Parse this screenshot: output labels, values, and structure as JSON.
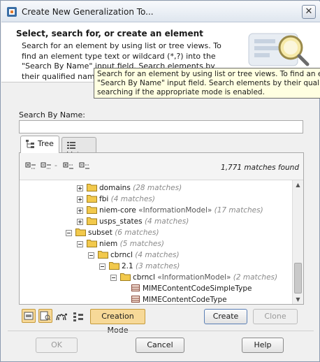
{
  "window": {
    "title": "Create New Generalization To..."
  },
  "header": {
    "title": "Select, search for, or create an element",
    "description": "Search for an element by using list or tree views. To find an element type text or wildcard (*,?) into the \"Search By Name\" input field. Search elements by their qualified names or use camel case when sear"
  },
  "tooltip": {
    "line1": "Search for an element by using list or tree views. To find an element",
    "line2": "\"Search By Name\" input field. Search elements by their qualified na",
    "line3": "searching if the appropriate mode is enabled."
  },
  "search": {
    "label": "Search By Name:",
    "value": ""
  },
  "tabs": [
    {
      "label": "Tree",
      "active": true
    },
    {
      "label": "List",
      "active": false
    }
  ],
  "tree": {
    "matches_found": "1,771 matches found",
    "rows": [
      {
        "name": "domains",
        "stereotype": "",
        "matches": "(28 matches)",
        "type": "folder",
        "expanded": false
      },
      {
        "name": "fbi",
        "stereotype": "",
        "matches": "(4 matches)",
        "type": "folder",
        "expanded": false
      },
      {
        "name": "niem-core",
        "stereotype": "«InformationModel»",
        "matches": "(17 matches)",
        "type": "folder",
        "expanded": false
      },
      {
        "name": "usps_states",
        "stereotype": "",
        "matches": "(4 matches)",
        "type": "folder",
        "expanded": false
      },
      {
        "name": "subset",
        "stereotype": "",
        "matches": "(6 matches)",
        "type": "folder",
        "expanded": true
      },
      {
        "name": "niem",
        "stereotype": "",
        "matches": "(5 matches)",
        "type": "folder",
        "expanded": true
      },
      {
        "name": "cbrncl",
        "stereotype": "",
        "matches": "(4 matches)",
        "type": "folder",
        "expanded": true
      },
      {
        "name": "2.1",
        "stereotype": "",
        "matches": "(3 matches)",
        "type": "folder",
        "expanded": true
      },
      {
        "name": "cbrncl",
        "stereotype": "«InformationModel»",
        "matches": "(2 matches)",
        "type": "folder",
        "expanded": true
      },
      {
        "name": "MIMEContentCodeSimpleType",
        "stereotype": "",
        "matches": "",
        "type": "class",
        "expanded": null
      },
      {
        "name": "MIMEContentCodeType",
        "stereotype": "",
        "matches": "",
        "type": "class",
        "expanded": null
      }
    ]
  },
  "toolbar": {
    "creation_mode_label": "Creation Mode",
    "create_label": "Create",
    "clone_label": "Clone"
  },
  "footer": {
    "ok_label": "OK",
    "cancel_label": "Cancel",
    "help_label": "Help"
  },
  "colors": {
    "folder": "#f2c94c",
    "toggle_active": "#f7d998",
    "tooltip_bg": "#ffffe1"
  }
}
